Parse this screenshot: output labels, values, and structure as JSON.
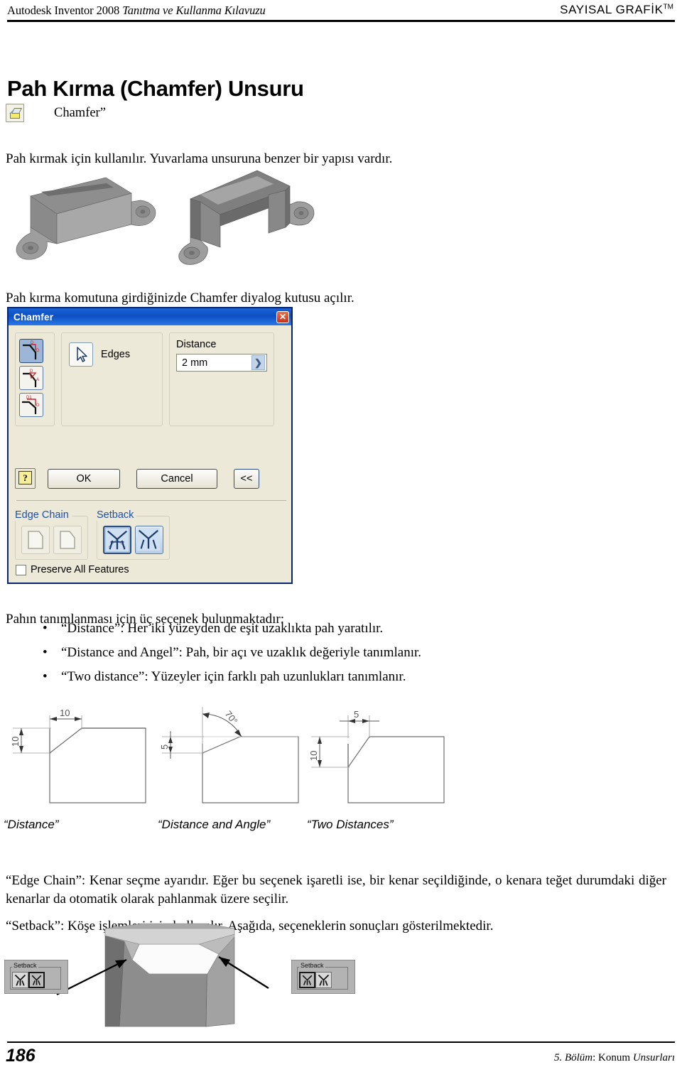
{
  "header": {
    "left_plain": "Autodesk Inventor 2008 ",
    "left_italic": "Tanıtma ve Kullanma Kılavuzu",
    "right": "SAYISAL GRAFİK",
    "right_tm": "TM"
  },
  "title": "Pah Kırma (Chamfer) Unsuru",
  "command": {
    "icon": "chamfer-icon",
    "label": "Chamfer”"
  },
  "paragraphs": {
    "intro": "Pah kırmak için kullanılır. Yuvarlama unsuruna benzer bir yapısı vardır.",
    "dialog_intro": "Pah kırma komutuna girdiğinizde Chamfer diyalog kutusu açılır.",
    "options_intro": "Pahın tanımlanması için üç seçenek bulunmaktadır:",
    "edge_chain": "“Edge Chain”: Kenar seçme ayarıdır. Eğer bu seçenek işaretli ise, bir kenar seçildiğinde, o kenara teğet durumdaki diğer kenarlar da otomatik olarak pahlanmak üzere seçilir.",
    "setback": "“Setback”: Köşe işlemleri için kullanılır. Aşağıda, seçeneklerin sonuçları gösterilmektedir."
  },
  "bullets": [
    "“Distance”: Her iki yüzeyden de eşit uzaklıkta pah yaratılır.",
    "“Distance and Angel”: Pah, bir açı ve uzaklık değeriyle tanımlanır.",
    "“Two distance”: Yüzeyler için farklı pah uzunlukları tanımlanır."
  ],
  "dialog": {
    "title": "Chamfer",
    "close_icon": "✕",
    "modes": [
      {
        "name": "distance-mode",
        "labels": [
          "D",
          "D"
        ],
        "selected": true
      },
      {
        "name": "distance-angle-mode",
        "labels": [
          "D",
          "A"
        ],
        "selected": false
      },
      {
        "name": "two-distance-mode",
        "labels": [
          "D1",
          "D"
        ],
        "selected": false
      }
    ],
    "edges_label": "Edges",
    "distance_label": "Distance",
    "distance_value": "2 mm",
    "distance_arrow": "❯",
    "help_symbol": "?",
    "ok_label": "OK",
    "cancel_label": "Cancel",
    "less_label": "<<",
    "edge_chain_group": "Edge Chain",
    "setback_group": "Setback",
    "preserve_label": "Preserve All Features"
  },
  "drawings": {
    "captions": [
      "“Distance”",
      "“Distance and Angle”",
      "“Two Distances”"
    ],
    "dims": {
      "d1_horizontal": "10",
      "d1_vertical": "10",
      "d2_vertical": "5",
      "d2_angle": "70",
      "d2_angle_unit": "°",
      "d3_horizontal": "5",
      "d3_vertical": "10"
    }
  },
  "setback_figure": {
    "panel_title": "Setback",
    "left_panel_selected_index": 1,
    "right_panel_selected_index": 0
  },
  "footer": {
    "page_number": "186",
    "chapter_italic_a": "5. Bölüm",
    "chapter_plain": ": Konum ",
    "chapter_italic_b": "Unsurları"
  },
  "colors": {
    "titlebar_blue": "#0d4fc4",
    "dialog_face": "#ece9d8",
    "group_label_blue": "#1f4fa8",
    "selected_button": "#9db6d8"
  }
}
